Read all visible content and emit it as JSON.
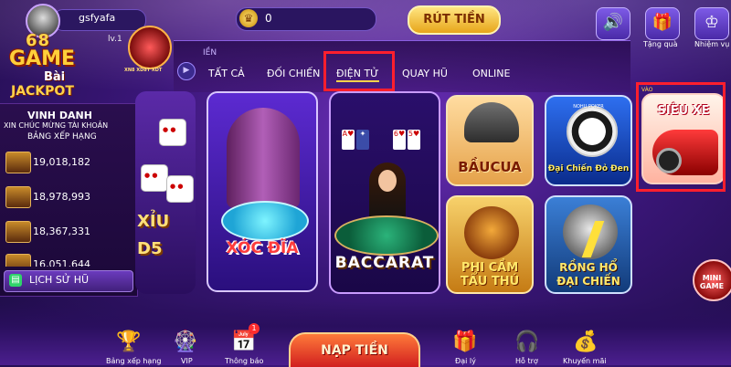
{
  "header": {
    "username": "gsfyafa",
    "level": "lv.1",
    "coins": "0",
    "withdraw_label": "RÚT TIỀN",
    "top_icons": [
      {
        "name": "sound-icon",
        "label": ""
      },
      {
        "name": "gift-icon",
        "label": "Tặng quà"
      },
      {
        "name": "mission-icon",
        "label": "Nhiệm vụ"
      }
    ]
  },
  "logo": {
    "number": "68",
    "game": "GAME",
    "bai": "Bài",
    "jackpot": "JACKPOT",
    "badge_text": "XN8 XD8T XDT"
  },
  "honor": {
    "title": "VINH DANH",
    "subtitle": "XIN CHÚC MỪNG TÀI KHOẢN",
    "ranking_title": "BẢNG XẾP HẠNG",
    "entries": [
      "19,018,182",
      "18,978,993",
      "18,367,331",
      "16,051,644"
    ],
    "history_label": "LỊCH SỬ HŨ"
  },
  "tabs": {
    "heading": "IỀN",
    "items": [
      "TẤT CẢ",
      "ĐỐI CHIẾN",
      "ĐIỆN TỬ",
      "QUAY HŨ",
      "ONLINE"
    ],
    "active_index": 2
  },
  "games": {
    "taixiu": "XỈU\nD5",
    "xocdia": "XÓC ĐĨA",
    "baccarat": "BACCARAT",
    "baucua": "BẦUCUA",
    "dcdd_top": "NOHU POKER",
    "dcdd": "Đại Chiến Đỏ Đen",
    "sieuxe_tag": "VÀO",
    "sieuxe": "SIÊU XE",
    "phicam": "PHI CẦM\nTẨU THÚ",
    "ronghodc": "RỒNG HỔ\nĐẠI CHIẾN"
  },
  "mini_game": "MINI\nGAME",
  "bottom": {
    "items": [
      {
        "label": "Bảng xếp hạng"
      },
      {
        "label": "VIP"
      },
      {
        "label": "Thông báo"
      },
      {
        "label": "Đại lý"
      },
      {
        "label": "Hỗ trợ"
      },
      {
        "label": "Khuyến mãi"
      }
    ],
    "deposit_label": "NẠP TIỀN",
    "notification_count": "1"
  }
}
